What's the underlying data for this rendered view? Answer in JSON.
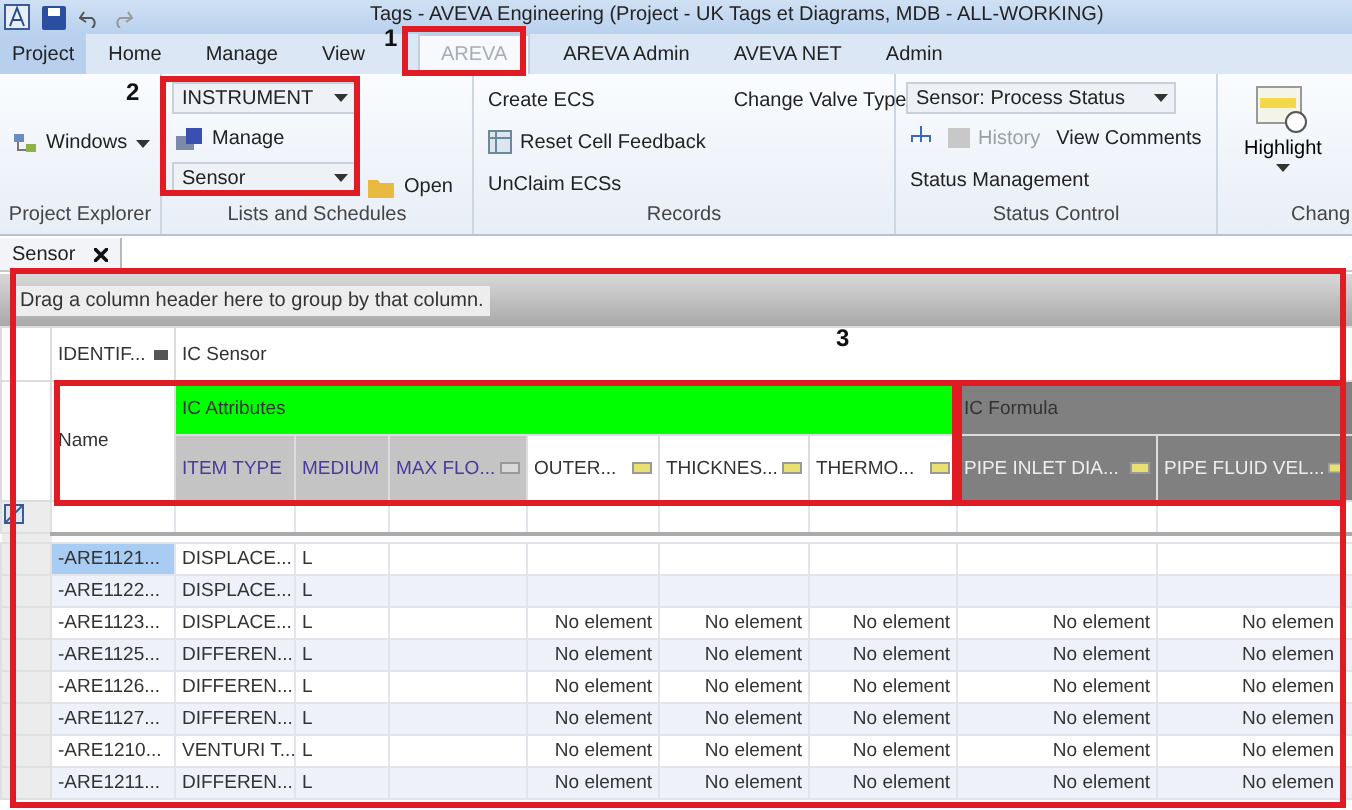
{
  "window": {
    "title": "Tags - AVEVA Engineering (Project - UK Tags et Diagrams, MDB - ALL-WORKING)"
  },
  "tabs": [
    {
      "label": "Project",
      "kind": "application",
      "selected": false
    },
    {
      "label": "Home",
      "kind": "tab",
      "selected": false
    },
    {
      "label": "Manage",
      "kind": "tab",
      "selected": false
    },
    {
      "label": "View",
      "kind": "tab",
      "selected": false
    },
    {
      "label": "AREVA",
      "kind": "tab",
      "selected": true
    },
    {
      "label": "AREVA Admin",
      "kind": "tab",
      "selected": false
    },
    {
      "label": "AVEVA NET",
      "kind": "tab",
      "selected": false
    },
    {
      "label": "Admin",
      "kind": "tab",
      "selected": false
    }
  ],
  "ribbon": {
    "project_explorer": {
      "label": "Project Explorer",
      "windows": "Windows"
    },
    "lists_and_schedules": {
      "label": "Lists and Schedules",
      "list_dropdown": "INSTRUMENT",
      "manage": "Manage",
      "type_dropdown": "Sensor",
      "open": "Open"
    },
    "records": {
      "label": "Records",
      "create": "Create ECS",
      "reset": "Reset Cell Feedback",
      "unclaim": "UnClaim ECSs",
      "change_valve": "Change Valve Type"
    },
    "status_control": {
      "label": "Status Control",
      "status_dropdown": "Sensor: Process Status",
      "history": "History",
      "history_disabled": true,
      "view_comments": "View Comments",
      "status_management": "Status Management"
    },
    "change": {
      "label": "Chang",
      "highlight": "Highlight"
    }
  },
  "document_tabs": [
    {
      "label": "Sensor",
      "selected": true
    }
  ],
  "grid": {
    "group_by_hint": "Drag a column header here to group by that column.",
    "identifier_header": "IDENTIF...",
    "sensor_band": "IC Sensor",
    "name_header": "Name",
    "bands": [
      {
        "label": "IC Attributes",
        "color": "#00ff00",
        "columns": [
          {
            "label": "ITEM TYPE",
            "kind": "key"
          },
          {
            "label": "MEDIUM",
            "kind": "key"
          },
          {
            "label": "MAX FLO...",
            "kind": "key"
          },
          {
            "label": "OUTER...",
            "kind": "attribute"
          },
          {
            "label": "THICKNES...",
            "kind": "attribute"
          },
          {
            "label": "THERMO...",
            "kind": "attribute"
          }
        ]
      },
      {
        "label": "IC Formula",
        "color": "#808080",
        "columns": [
          {
            "label": "PIPE INLET DIA...",
            "kind": "formula"
          },
          {
            "label": "PIPE FLUID VEL...",
            "kind": "formula"
          }
        ]
      }
    ],
    "rows": [
      {
        "selected": true,
        "cells": [
          "-ARE1121...",
          "DISPLACE...",
          "L",
          null,
          null,
          null,
          null,
          null,
          null
        ]
      },
      {
        "selected": false,
        "cells": [
          "-ARE1122...",
          "DISPLACE...",
          "L",
          null,
          null,
          null,
          null,
          null,
          null
        ]
      },
      {
        "selected": false,
        "cells": [
          "-ARE1123...",
          "DISPLACE...",
          "L",
          null,
          "No element",
          "No element",
          "No element",
          "No element",
          "No elemen"
        ]
      },
      {
        "selected": false,
        "cells": [
          "-ARE1125...",
          "DIFFEREN...",
          "L",
          null,
          "No element",
          "No element",
          "No element",
          "No element",
          "No elemen"
        ]
      },
      {
        "selected": false,
        "cells": [
          "-ARE1126...",
          "DIFFEREN...",
          "L",
          null,
          "No element",
          "No element",
          "No element",
          "No element",
          "No elemen"
        ]
      },
      {
        "selected": false,
        "cells": [
          "-ARE1127...",
          "DIFFEREN...",
          "L",
          null,
          "No element",
          "No element",
          "No element",
          "No element",
          "No elemen"
        ]
      },
      {
        "selected": false,
        "cells": [
          "-ARE1210...",
          "VENTURI T...",
          "L",
          null,
          "No element",
          "No element",
          "No element",
          "No element",
          "No elemen"
        ]
      },
      {
        "selected": false,
        "cells": [
          "-ARE1211...",
          "DIFFEREN...",
          "L",
          null,
          "No element",
          "No element",
          "No element",
          "No element",
          "No elemen"
        ]
      }
    ]
  },
  "annotations": [
    {
      "label": "1"
    },
    {
      "label": "2"
    },
    {
      "label": "3"
    }
  ]
}
